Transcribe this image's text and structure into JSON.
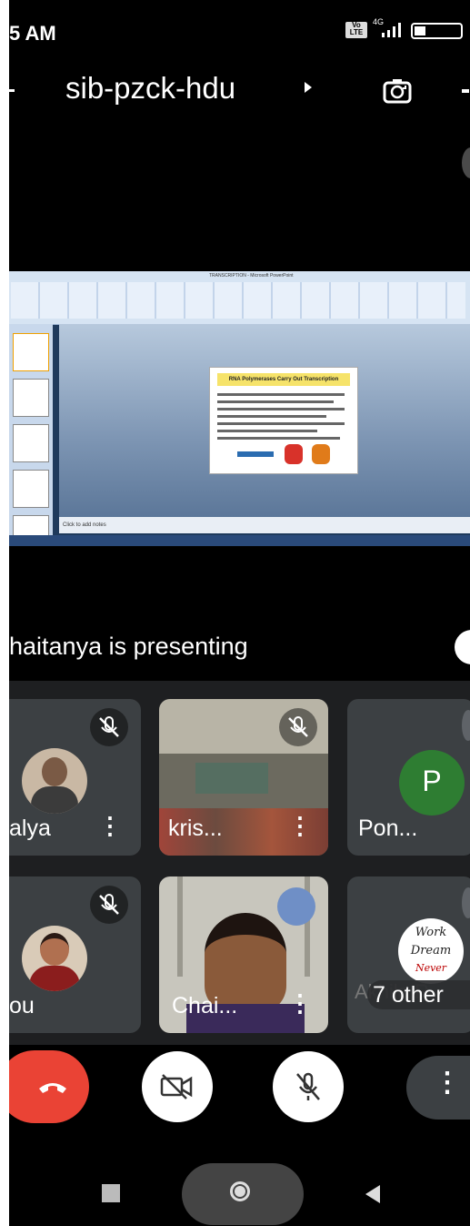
{
  "status_bar": {
    "time": "5 AM",
    "network": "4G",
    "volte": "Vo LTE"
  },
  "meeting": {
    "code": "sib-pzck-hdu"
  },
  "presentation": {
    "window_title": "TRANSCRIPTION - Microsoft PowerPoint",
    "slide_title": "RNA Polymerases Carry Out Transcription",
    "notes_placeholder": "Click to add notes",
    "presenter_text": "haitanya is presenting"
  },
  "participants": [
    {
      "name": "alya",
      "muted": true,
      "type": "photo"
    },
    {
      "name": "kris...",
      "muted": true,
      "type": "video"
    },
    {
      "name": "Pon...",
      "muted": false,
      "type": "initial",
      "initial": "P",
      "color": "#2e7d32"
    },
    {
      "name": "ou",
      "muted": true,
      "type": "photo"
    },
    {
      "name": "Chai...",
      "muted": false,
      "type": "video"
    },
    {
      "name": "7 other",
      "muted": false,
      "type": "group",
      "behind_name": "Akhila R",
      "badge_lines": [
        "Work",
        "Dream",
        "Never"
      ]
    }
  ],
  "controls": {
    "end_call_color": "#ea4335",
    "button_color": "#ffffff",
    "more_color": "#3c4043"
  }
}
